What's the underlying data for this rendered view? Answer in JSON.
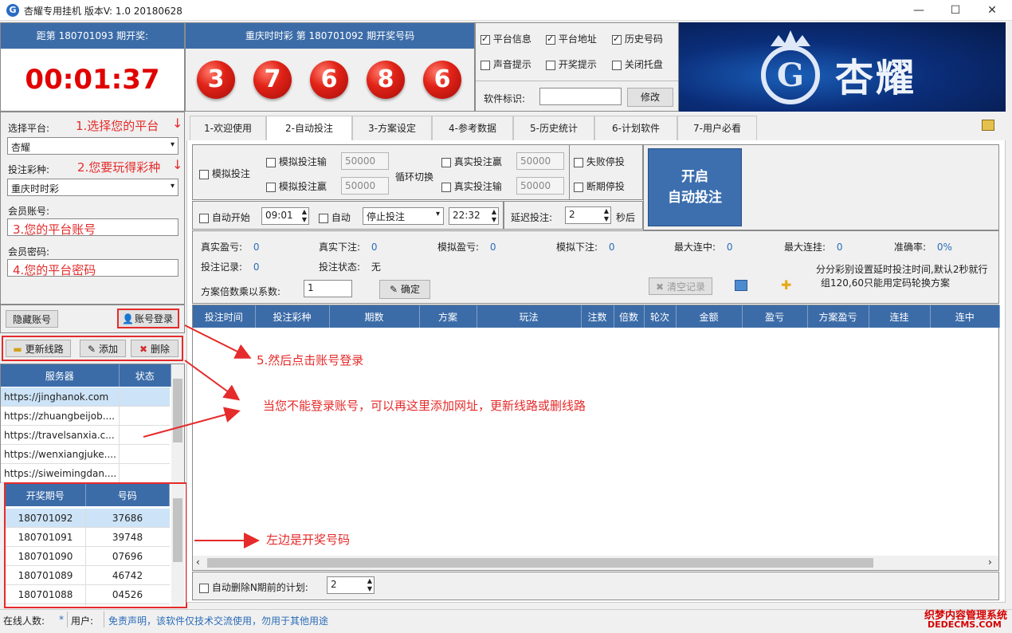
{
  "window": {
    "title": "杏耀专用挂机  版本V: 1.0  20180628",
    "minimize": "—",
    "maximize": "☐",
    "close": "✕"
  },
  "countdown": {
    "header": "距第 180701093 期开奖:",
    "time": "00:01:37"
  },
  "result": {
    "header": "重庆时时彩 第 180701092 期开奖号码",
    "balls": [
      "3",
      "7",
      "6",
      "8",
      "6"
    ]
  },
  "options": {
    "row1": [
      {
        "label": "平台信息",
        "checked": true
      },
      {
        "label": "平台地址",
        "checked": true
      },
      {
        "label": "历史号码",
        "checked": true
      }
    ],
    "row2": [
      {
        "label": "声音提示",
        "checked": false
      },
      {
        "label": "开奖提示",
        "checked": false
      },
      {
        "label": "关闭托盘",
        "checked": false
      }
    ],
    "software_id_label": "软件标识:",
    "software_id_value": "",
    "modify_button": "修改"
  },
  "banner": {
    "brand": "杏耀"
  },
  "login": {
    "platform_label": "选择平台:",
    "platform_value": "杏耀",
    "lottery_label": "投注彩种:",
    "lottery_value": "重庆时时彩",
    "account_label": "会员账号:",
    "account_value": "3.您的平台账号",
    "password_label": "会员密码:",
    "password_value": "4.您的平台密码",
    "hide_button": "隐藏账号",
    "login_button": "账号登录"
  },
  "annotations": {
    "a1": "1.选择您的平台",
    "a2": "2.您要玩得彩种",
    "a5": "5.然后点击账号登录",
    "a6": "当您不能登录账号，可以再这里添加网址，更新线路或删线路",
    "a7": "左边是开奖号码"
  },
  "server_toolbar": {
    "update": "更新线路",
    "add": "添加",
    "delete": "删除"
  },
  "servers": {
    "headers": [
      "服务器",
      "状态"
    ],
    "rows": [
      "https://jinghanok.com",
      "https://zhuangbeijob....",
      "https://travelsanxia.c...",
      "https://wenxiangjuke....",
      "https://siweimingdan...."
    ]
  },
  "draws": {
    "headers": [
      "开奖期号",
      "号码"
    ],
    "rows": [
      [
        "180701092",
        "37686"
      ],
      [
        "180701091",
        "39748"
      ],
      [
        "180701090",
        "07696"
      ],
      [
        "180701089",
        "46742"
      ],
      [
        "180701088",
        "04526"
      ]
    ]
  },
  "tabs": [
    "1-欢迎使用",
    "2-自动投注",
    "3-方案设定",
    "4-参考数据",
    "5-历史统计",
    "6-计划软件",
    "7-用户必看"
  ],
  "auto_bet": {
    "sim_bet": "模拟投注",
    "sim_lose": "模拟投注输",
    "sim_win": "模拟投注赢",
    "cycle": "循环切换",
    "real_win": "真实投注赢",
    "real_lose": "真实投注输",
    "v1": "50000",
    "v2": "50000",
    "v3": "50000",
    "v4": "50000",
    "fail_stop": "失败停投",
    "break_stop": "断期停投",
    "start_button": "开启\n自动投注",
    "auto_start": "自动开始",
    "start_time": "09:01",
    "auto": "自动",
    "mode": "停止投注",
    "end_time": "22:32",
    "delay_label": "延迟投注:",
    "delay_value": "2",
    "delay_unit": "秒后"
  },
  "stats": {
    "real_profit": "真实盈亏:",
    "real_profit_v": "0",
    "real_bet": "真实下注:",
    "real_bet_v": "0",
    "sim_profit": "模拟盈亏:",
    "sim_profit_v": "0",
    "sim_bet": "模拟下注:",
    "sim_bet_v": "0",
    "max_win": "最大连中:",
    "max_win_v": "0",
    "max_lose": "最大连挂:",
    "max_lose_v": "0",
    "accuracy": "准确率:",
    "accuracy_v": "0%",
    "record": "投注记录:",
    "record_v": "0",
    "status": "投注状态:",
    "status_v": "无",
    "note1": "分分彩别设置延时投注时间,默认2秒就行",
    "note2": "组120,60只能用定码轮换方案",
    "multiplier_label": "方案倍数乘以系数:",
    "multiplier_value": "1",
    "confirm": "确定",
    "clear": "清空记录"
  },
  "bet_table": {
    "headers": [
      "投注时间",
      "投注彩种",
      "期数",
      "方案",
      "玩法",
      "注数",
      "倍数",
      "轮次",
      "金额",
      "盈亏",
      "方案盈亏",
      "连挂",
      "连中"
    ]
  },
  "bottom": {
    "auto_delete": "自动删除N期前的计划:",
    "value": "2"
  },
  "statusbar": {
    "online": "在线人数:",
    "online_v": "*",
    "user": "用户:",
    "disclaimer": "免责声明，该软件仅技术交流使用，勿用于其他用途",
    "watermark1": "织梦内容管理系统",
    "watermark2": "DEDECMS.COM"
  },
  "colors": {
    "header_blue": "#3c6ca8",
    "annotation_red": "#e52b2b",
    "timer_red": "#e00000"
  }
}
